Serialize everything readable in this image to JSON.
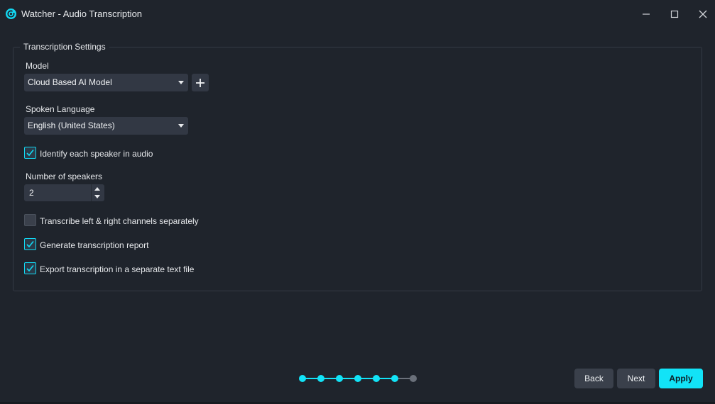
{
  "window": {
    "title": "Watcher - Audio Transcription",
    "accent_color": "#12e3f7"
  },
  "group": {
    "title": "Transcription Settings"
  },
  "model": {
    "label": "Model",
    "selected": "Cloud Based AI Model"
  },
  "language": {
    "label": "Spoken Language",
    "selected": "English (United States)"
  },
  "options": {
    "identify_speakers": {
      "label": "Identify each speaker in audio",
      "checked": true
    },
    "separate_channels": {
      "label": "Transcribe left & right channels separately",
      "checked": false
    },
    "generate_report": {
      "label": "Generate transcription report",
      "checked": true
    },
    "export_text": {
      "label": "Export transcription in a separate text file",
      "checked": true
    }
  },
  "speakers": {
    "label": "Number of speakers",
    "value": "2"
  },
  "stepper": {
    "total_steps": 7,
    "current_step": 6
  },
  "buttons": {
    "back": "Back",
    "next": "Next",
    "apply": "Apply"
  },
  "icons": {
    "app": "watcher-logo-icon",
    "minimize": "minimize-icon",
    "maximize": "maximize-icon",
    "close": "close-icon",
    "add": "plus-icon",
    "check": "checkmark-icon"
  }
}
